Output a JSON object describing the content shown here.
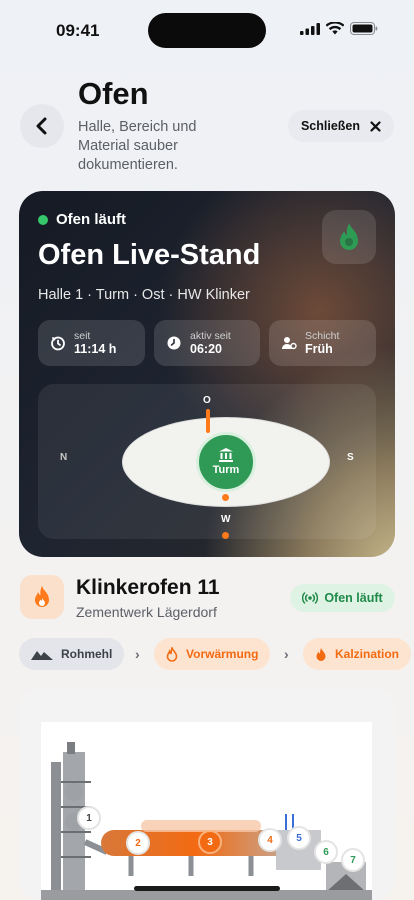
{
  "status_bar": {
    "time": "09:41"
  },
  "header": {
    "title": "Ofen",
    "subtitle": "Halle, Bereich und Material sauber dokumentieren.",
    "close_label": "Schließen"
  },
  "hero": {
    "status": "Ofen läuft",
    "title": "Ofen Live-Stand",
    "location": "Halle 1 · Turm · Ost · HW Klinker",
    "stats": [
      {
        "label": "seit",
        "value": "11:14 h"
      },
      {
        "label": "aktiv seit",
        "value": "06:20"
      },
      {
        "label": "Schicht",
        "value": "Früh"
      }
    ],
    "compass": {
      "n": "N",
      "o": "O",
      "s": "S",
      "w": "W",
      "center_label": "Turm"
    }
  },
  "kiln": {
    "name": "Klinkerofen 11",
    "plant": "Zementwerk Lägerdorf",
    "status": "Ofen läuft"
  },
  "process_steps": [
    "Rohmehl",
    "Vorwärmung",
    "Kalzination"
  ],
  "diagram": {
    "markers": [
      "1",
      "2",
      "3",
      "4",
      "5",
      "6",
      "7"
    ]
  },
  "colors": {
    "accent": "#ff7a1a",
    "running_green": "#2f9a55",
    "dark_card": "#1e2430"
  }
}
